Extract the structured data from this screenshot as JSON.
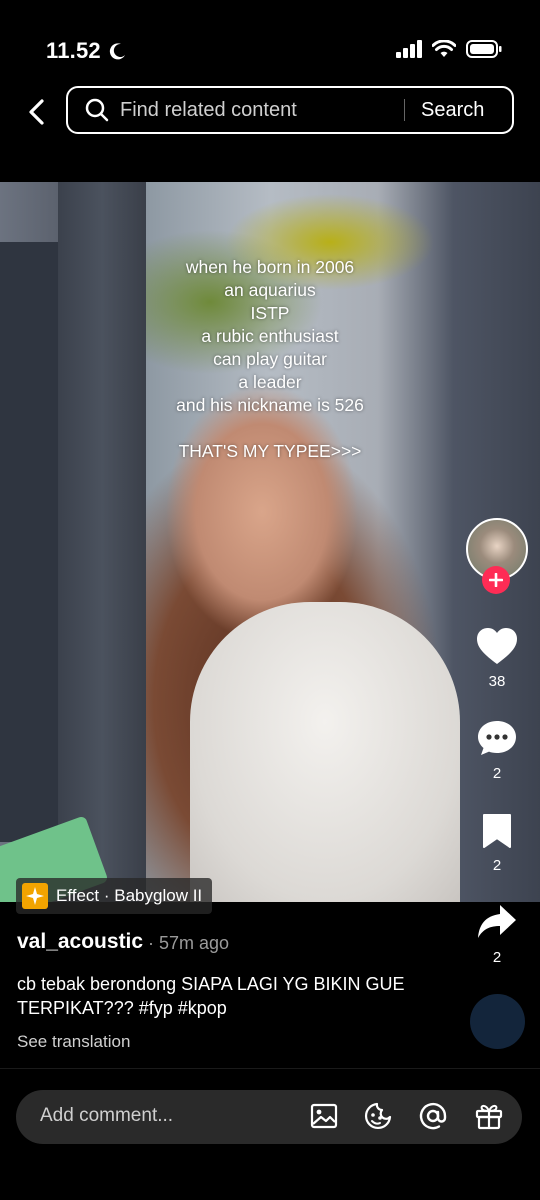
{
  "status_bar": {
    "time": "11.52"
  },
  "search": {
    "placeholder": "Find related content",
    "button_label": "Search"
  },
  "video": {
    "overlay_lines": [
      "when he born in 2006",
      "an aquarius",
      "ISTP",
      "a rubic enthusiast",
      "can play guitar",
      "a leader",
      "and his nickname is 526"
    ],
    "overlay_tail": "THAT'S MY TYPEE>>>"
  },
  "effect": {
    "label": "Effect · Babyglow II"
  },
  "actions": {
    "likes": "38",
    "comments": "2",
    "saves": "2",
    "shares": "2"
  },
  "post": {
    "username": "val_acoustic",
    "time_ago": "· 57m ago",
    "caption": "cb tebak berondong SIAPA LAGI YG BIKIN GUE TERPIKAT??? #fyp #kpop",
    "see_translation": "See translation"
  },
  "comment_bar": {
    "placeholder": "Add comment..."
  },
  "colors": {
    "follow_accent": "#fe2c55",
    "effect_icon": "#f2a400"
  }
}
